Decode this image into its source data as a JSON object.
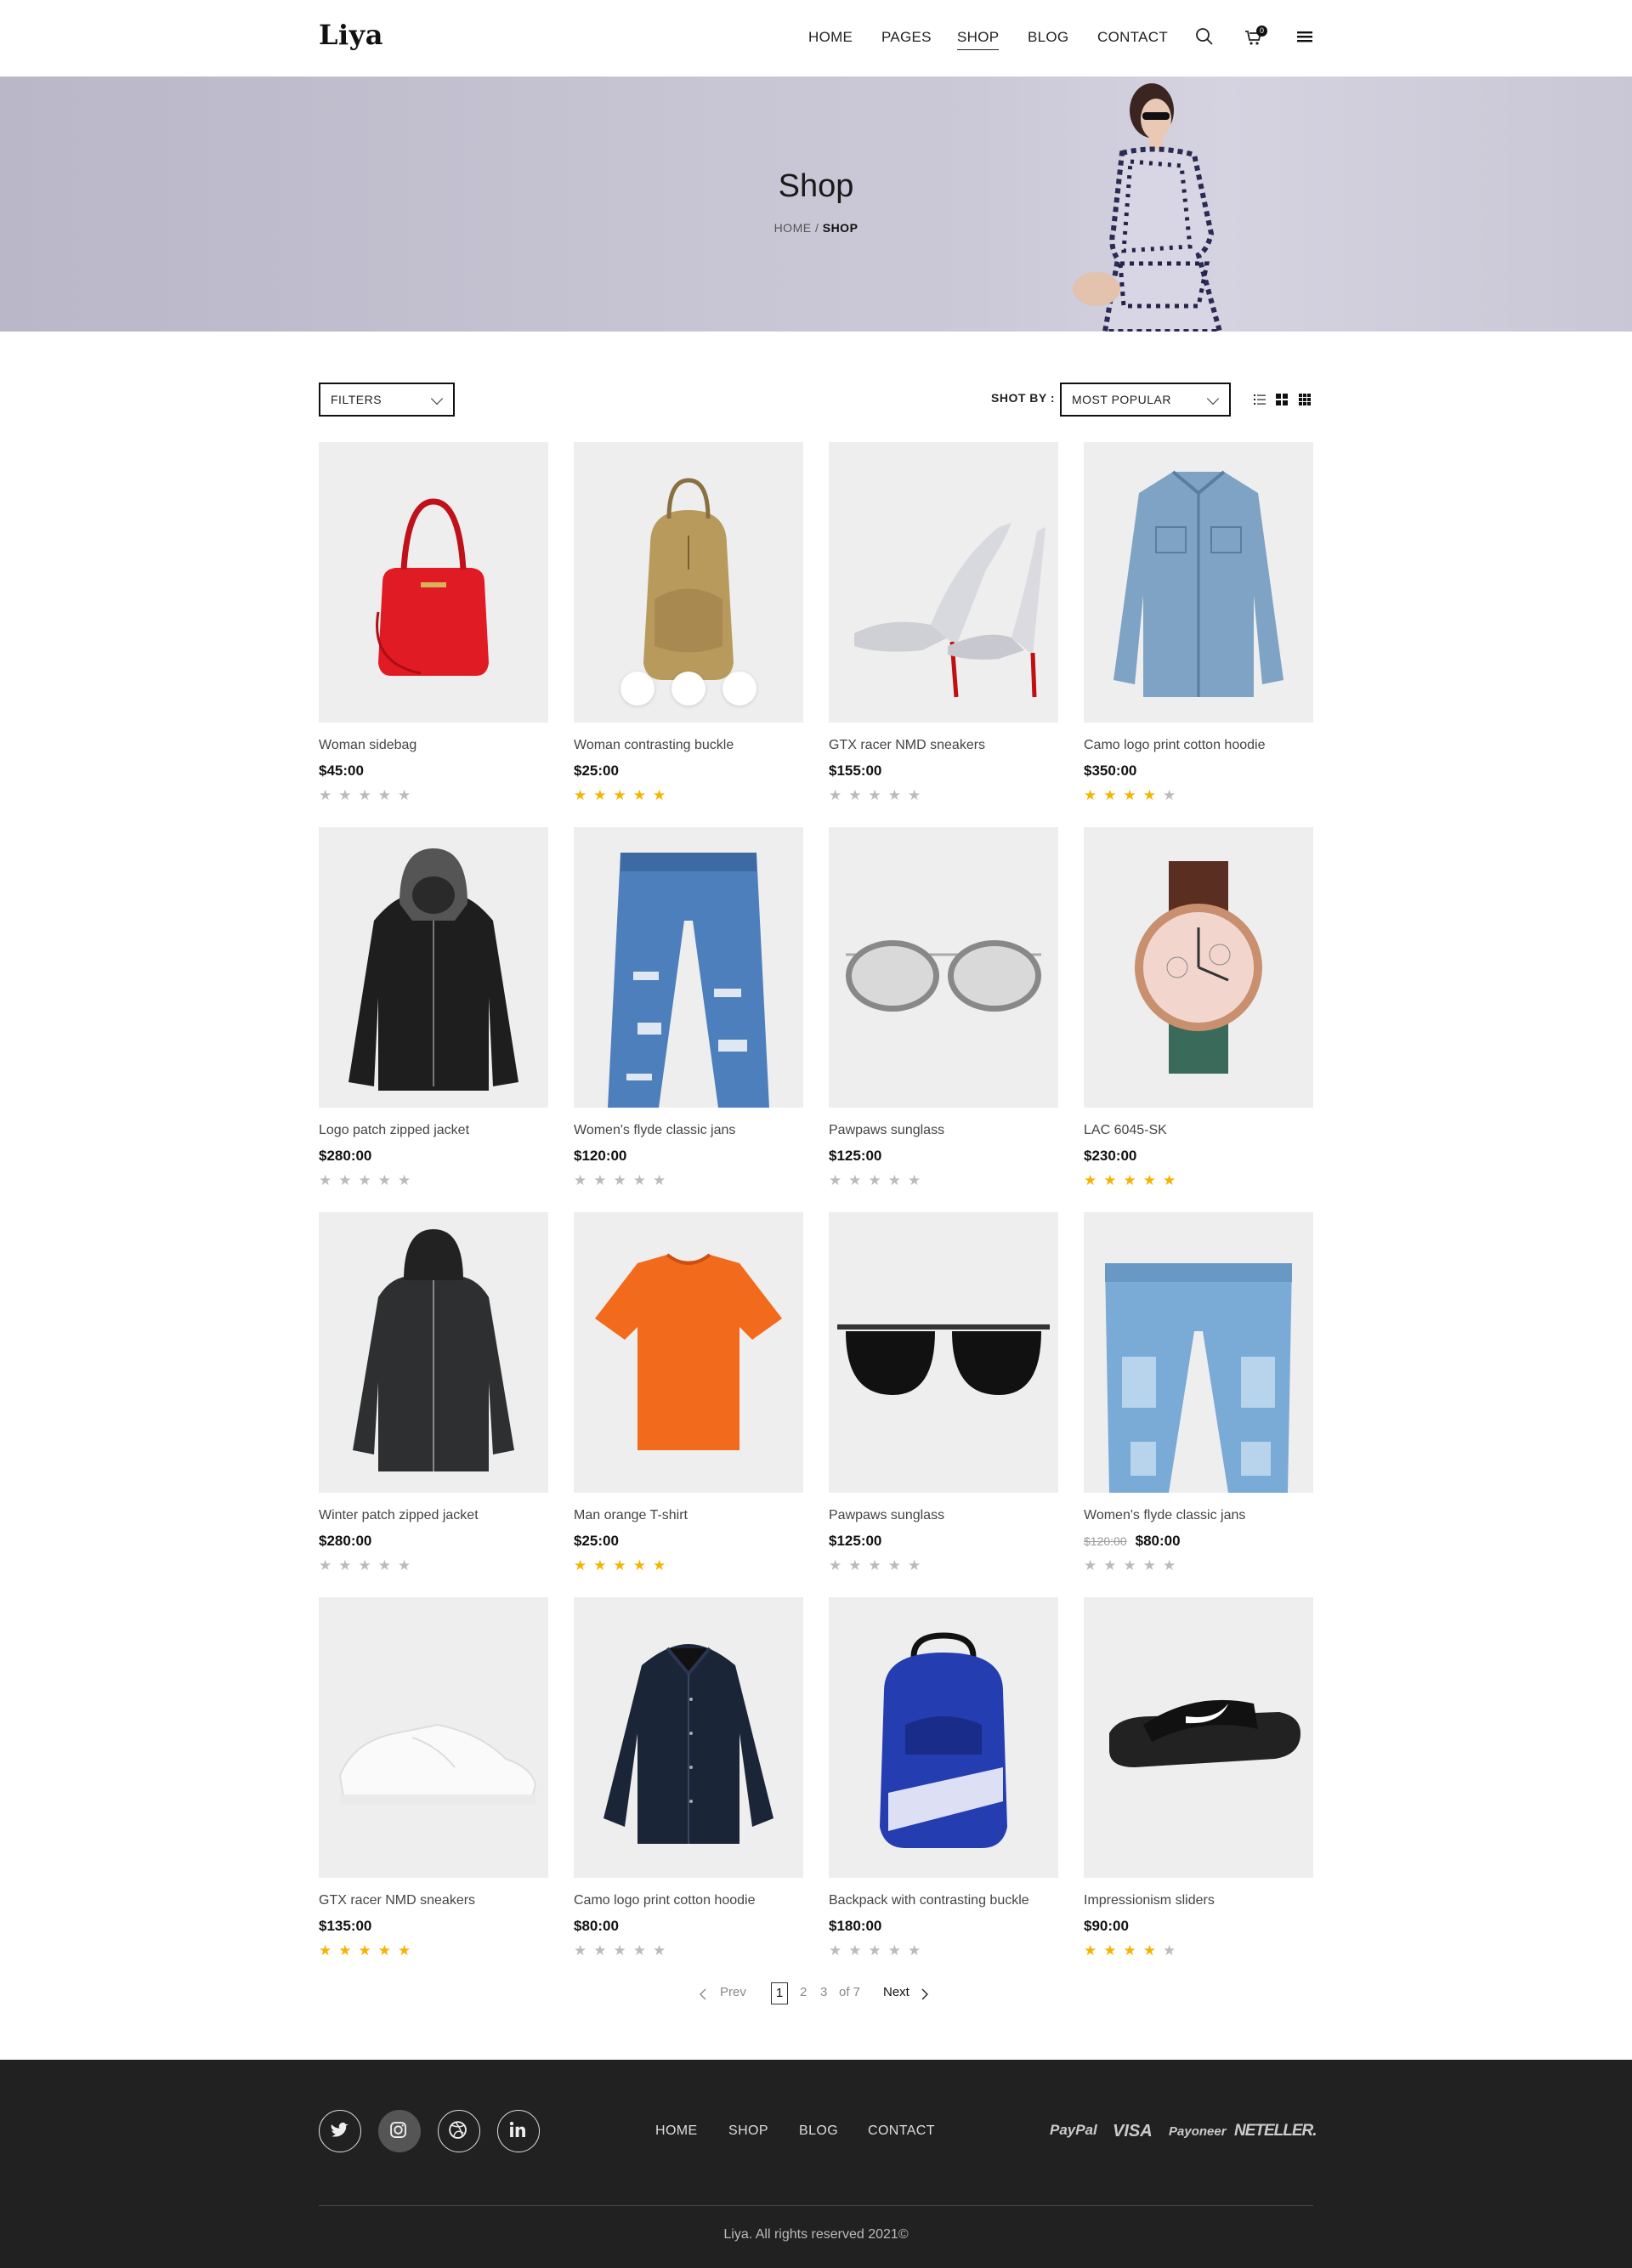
{
  "header": {
    "logo": "Liya",
    "nav": [
      "HOME",
      "PAGES",
      "SHOP",
      "BLOG",
      "CONTACT"
    ],
    "active_nav": "SHOP",
    "cart_count": "0",
    "icons": [
      "search-icon",
      "cart-icon",
      "menu-icon"
    ]
  },
  "banner": {
    "title": "Shop",
    "breadcrumb_home": "HOME",
    "breadcrumb_sep": " / ",
    "breadcrumb_current": "SHOP"
  },
  "toolbar": {
    "filters_label": "FILTERS",
    "sort_label": "SHOT BY :",
    "sort_value": "MOST POPULAR",
    "view_icons": [
      "list-view-icon",
      "grid-large-icon",
      "grid-small-icon"
    ]
  },
  "products": [
    {
      "name": "Woman sidebag",
      "price": "$45:00",
      "old_price": "",
      "rating": 0
    },
    {
      "name": "Woman contrasting buckle",
      "price": "$25:00",
      "old_price": "",
      "rating": 5
    },
    {
      "name": "GTX racer NMD sneakers",
      "price": "$155:00",
      "old_price": "",
      "rating": 0
    },
    {
      "name": "Camo logo print cotton hoodie",
      "price": "$350:00",
      "old_price": "",
      "rating": 4
    },
    {
      "name": "Logo patch zipped jacket",
      "price": "$280:00",
      "old_price": "",
      "rating": 0
    },
    {
      "name": "Women's flyde classic jans",
      "price": "$120:00",
      "old_price": "",
      "rating": 0
    },
    {
      "name": "Pawpaws  sunglass",
      "price": "$125:00",
      "old_price": "",
      "rating": 0
    },
    {
      "name": "LAC 6045-SK",
      "price": "$230:00",
      "old_price": "",
      "rating": 5
    },
    {
      "name": "Winter patch zipped jacket",
      "price": "$280:00",
      "old_price": "",
      "rating": 0
    },
    {
      "name": "Man orange T-shirt",
      "price": "$25:00",
      "old_price": "",
      "rating": 5
    },
    {
      "name": "Pawpaws  sunglass",
      "price": "$125:00",
      "old_price": "",
      "rating": 0
    },
    {
      "name": "Women's flyde classic jans",
      "price": "$80:00",
      "old_price": "$120:00",
      "rating": 0
    },
    {
      "name": "GTX racer NMD sneakers",
      "price": "$135:00",
      "old_price": "",
      "rating": 5
    },
    {
      "name": "Camo logo print cotton hoodie",
      "price": "$80:00",
      "old_price": "",
      "rating": 0
    },
    {
      "name": "Backpack with contrasting buckle",
      "price": "$180:00",
      "old_price": "",
      "rating": 0
    },
    {
      "name": "Impressionism sliders",
      "price": "$90:00",
      "old_price": "",
      "rating": 4
    }
  ],
  "hover_actions": [
    "cart-icon",
    "heart-icon",
    "zoom-icon"
  ],
  "pagination": {
    "prev": "Prev",
    "pages": [
      "1",
      "2",
      "3"
    ],
    "of": "of 7",
    "next": "Next",
    "current": "1"
  },
  "footer": {
    "social": [
      "twitter-icon",
      "instagram-icon",
      "dribbble-icon",
      "linkedin-icon"
    ],
    "nav": [
      "HOME",
      "SHOP",
      "BLOG",
      "CONTACT"
    ],
    "payments": [
      "PayPal",
      "VISA",
      "Payoneer",
      "NETELLER."
    ],
    "copyright": "Liya. All rights reserved 2021©"
  },
  "colors": {
    "star_on": "#f4b400",
    "star_off": "#bbbbbb",
    "footer_bg": "#212121",
    "banner_bg": "#c8c6d4"
  }
}
